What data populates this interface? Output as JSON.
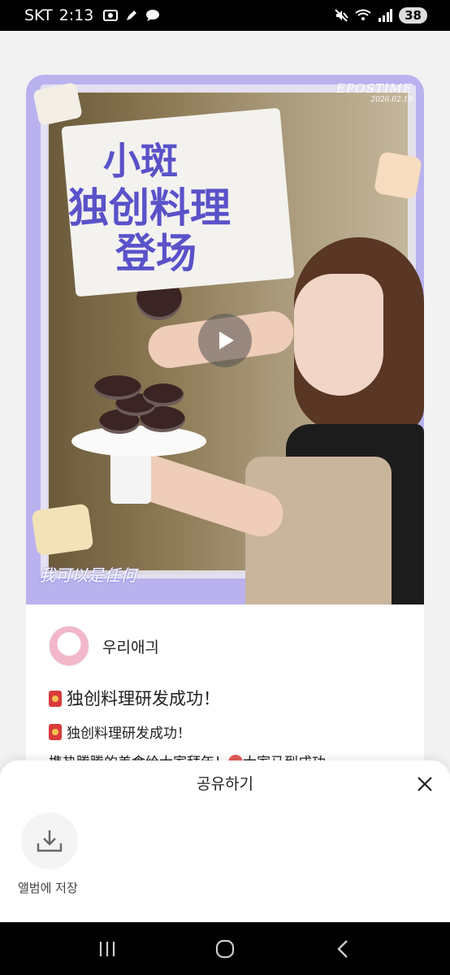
{
  "status_bar": {
    "carrier": "SKT",
    "time": "2:13",
    "battery": "38"
  },
  "poster": {
    "title_line1": "小斑",
    "title_line2": "独创料理",
    "title_line3": "登场",
    "stamp_line1": "EPOSTIME",
    "stamp_line2": "2026.02.19",
    "logo_text": "我可以是任何"
  },
  "post": {
    "author_name": "우리애긔",
    "title": "独创料理研发成功！",
    "line2": "独创料理研发成功！",
    "line3": "携热腾腾的美食给大家拜年！",
    "line3_tail": "大家马到成功"
  },
  "share_sheet": {
    "title": "공유하기",
    "save_label": "앨범에 저장"
  },
  "icons": {
    "play": "play-icon",
    "close": "close-icon",
    "download": "download-icon",
    "recents": "recents-icon",
    "home": "home-icon",
    "back": "back-icon"
  }
}
